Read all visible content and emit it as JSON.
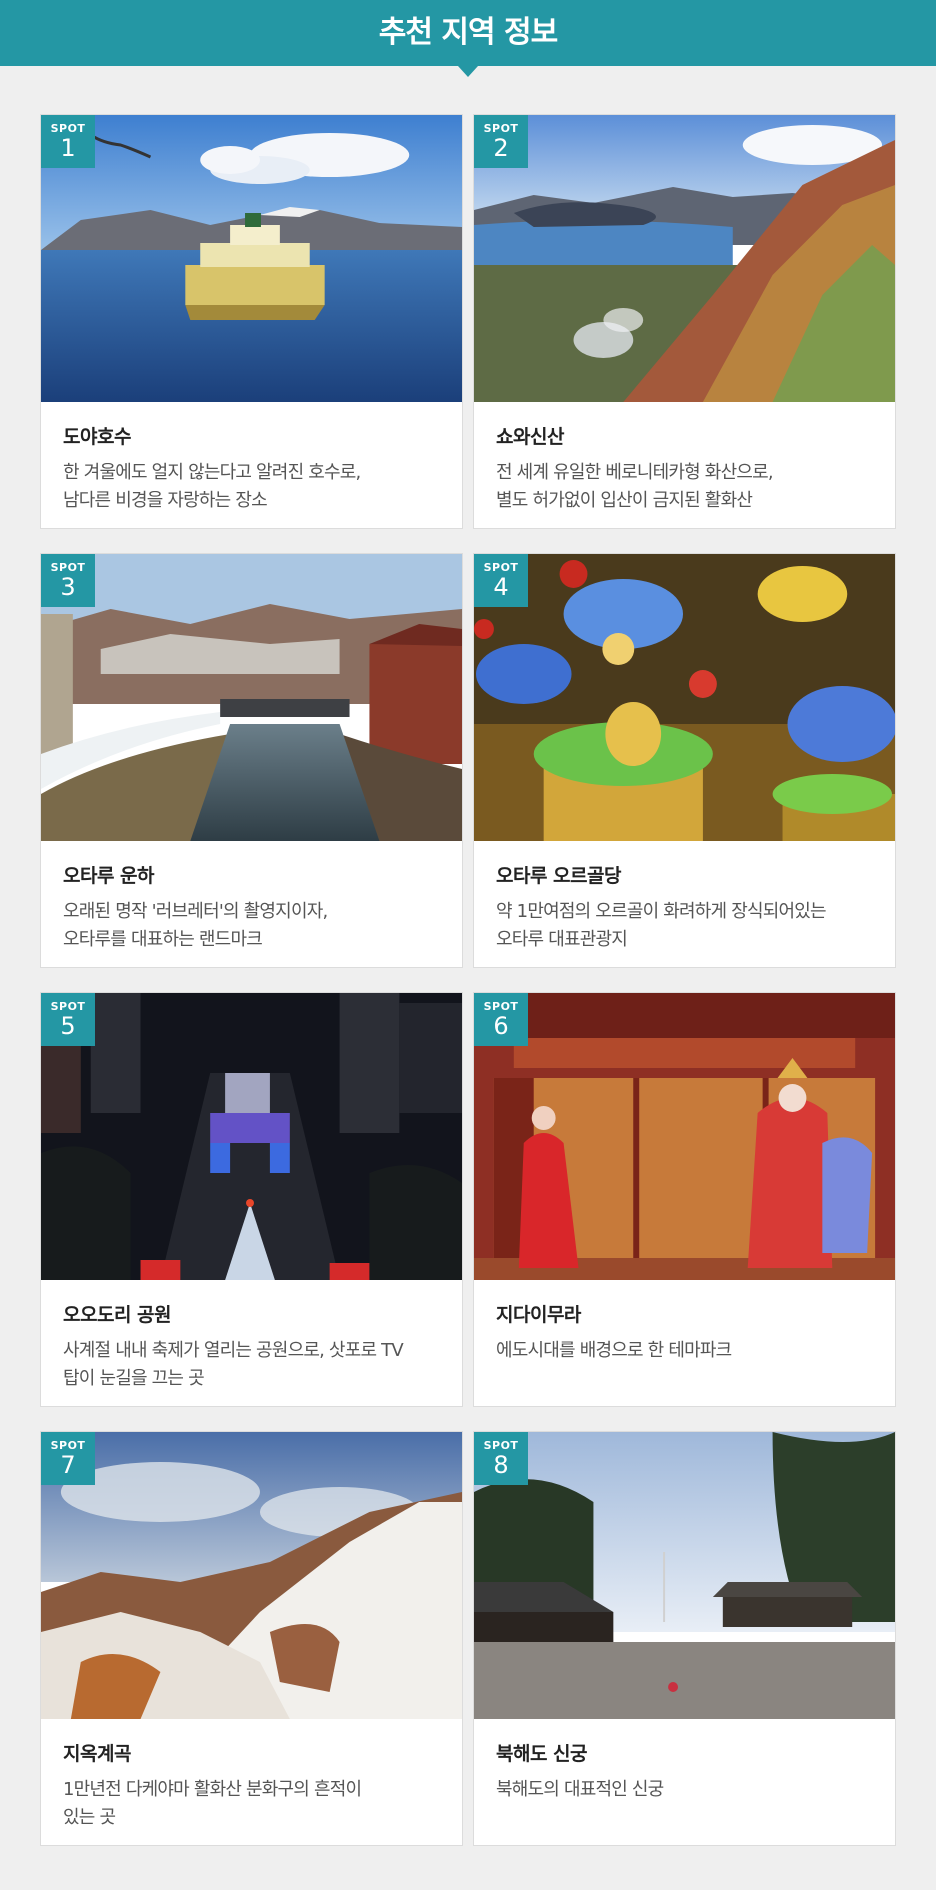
{
  "header": {
    "title": "추천 지역 정보"
  },
  "spots": [
    {
      "badge": "SPOT",
      "number": "1",
      "title": "도야호수",
      "desc": "한 겨울에도 얼지 않는다고 알려진 호수로,\n남다른 비경을 자랑하는 장소"
    },
    {
      "badge": "SPOT",
      "number": "2",
      "title": "쇼와신산",
      "desc": "전 세계 유일한 베로니테카형 화산으로,\n별도 허가없이 입산이 금지된 활화산"
    },
    {
      "badge": "SPOT",
      "number": "3",
      "title": "오타루 운하",
      "desc": "오래된 명작 '러브레터'의 촬영지이자,\n오타루를 대표하는 랜드마크"
    },
    {
      "badge": "SPOT",
      "number": "4",
      "title": "오타루 오르골당",
      "desc": "약 1만여점의 오르골이 화려하게 장식되어있는\n오타루 대표관광지"
    },
    {
      "badge": "SPOT",
      "number": "5",
      "title": "오오도리 공원",
      "desc": "사계절 내내 축제가 열리는 공원으로, 삿포로 TV\n탑이 눈길을 끄는 곳"
    },
    {
      "badge": "SPOT",
      "number": "6",
      "title": "지다이무라",
      "desc": "에도시대를 배경으로 한 테마파크"
    },
    {
      "badge": "SPOT",
      "number": "7",
      "title": "지옥계곡",
      "desc": "1만년전 다케야마 활화산 분화구의 흔적이\n있는 곳"
    },
    {
      "badge": "SPOT",
      "number": "8",
      "title": "북해도 신궁",
      "desc": "북해도의 대표적인 신궁"
    }
  ]
}
